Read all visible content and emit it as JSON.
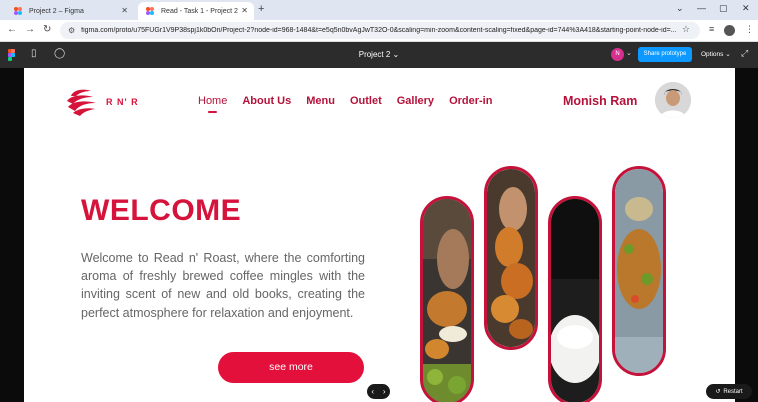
{
  "browser": {
    "tabs": [
      {
        "title": "Project 2 – Figma",
        "active": false
      },
      {
        "title": "Read - Task 1 - Project 2",
        "active": true
      }
    ],
    "url": "figma.com/proto/u75FUGr1V9P38spj1k0bOn/Project-2?node-id=968-1484&t=e5q5n0bvAgJwT32O-0&scaling=min-zoom&content-scaling=fixed&page-id=744%3A418&starting-point-node-id=..."
  },
  "figma": {
    "project_title": "Project 2",
    "user_initial": "N",
    "share_label": "Share prototype",
    "options_label": "Options"
  },
  "site": {
    "brand": "R N' R",
    "nav": [
      "Home",
      "About Us",
      "Menu",
      "Outlet",
      "Gallery",
      "Order-in"
    ],
    "user_name": "Monish Ram",
    "heading": "WELCOME",
    "intro": "Welcome to Read n' Roast, where the comforting aroma of freshly brewed coffee mingles with the inviting scent of new and old books, creating the perfect atmosphere for relaxation and enjoyment.",
    "cta": "see more"
  },
  "controls": {
    "prev": "‹",
    "next": "›",
    "restart": "Restart"
  },
  "colors": {
    "accent": "#d5133b",
    "figma_blue": "#0d99ff",
    "toolbar": "#2c2c2c"
  }
}
